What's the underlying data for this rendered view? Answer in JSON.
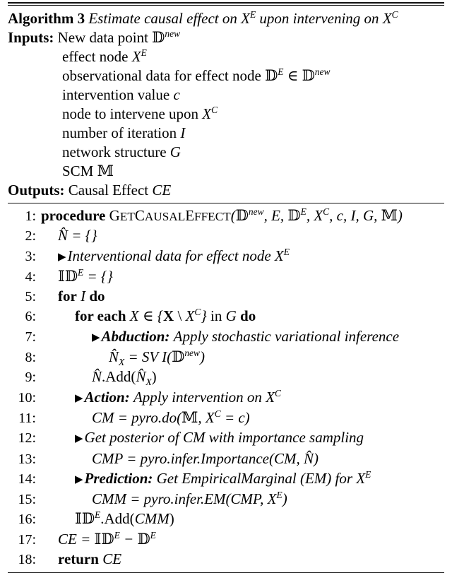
{
  "algorithm": {
    "label": "Algorithm",
    "number": "3",
    "caption": "Estimate causal effect on X^E upon intervening on X^C",
    "caption_parts": {
      "a": "Estimate causal effect on ",
      "x_effect": "X",
      "sup_e": "E",
      "b": " upon intervening on ",
      "x_cause": "X",
      "sup_c": "C"
    }
  },
  "inputs": {
    "label": "Inputs:",
    "items": [
      "New data point ℐnew",
      "effect node X^E",
      "observational data for effect node ℐ^E ∈ ℐ^new",
      "intervention value c",
      "node to intervene upon X^C",
      "number of iteration I",
      "network structure G",
      "SCM ᴹ"
    ]
  },
  "outputs": {
    "label": "Outputs:",
    "text": "Causal Effect CE"
  },
  "steps": [
    {
      "n": "1:",
      "indent": 0,
      "text": "procedure GETCAUSALEFFECT(ᴰnew, E, ᴰE, XC, c, I, G, ᴹ)"
    },
    {
      "n": "2:",
      "indent": 1,
      "text": "N̂ = {}"
    },
    {
      "n": "3:",
      "indent": 1,
      "text": "▶ Interventional data for effect node XE"
    },
    {
      "n": "4:",
      "indent": 1,
      "text": "ᵀᴰE = {}"
    },
    {
      "n": "5:",
      "indent": 1,
      "text": "for I do"
    },
    {
      "n": "6:",
      "indent": 2,
      "text": "for each X ∈ {X \\ XC} in G do"
    },
    {
      "n": "7:",
      "indent": 3,
      "text": "▶ Abduction: Apply stochastic variational inference"
    },
    {
      "n": "8:",
      "indent": 4,
      "text": "N̂X = SVI(ᴰnew)"
    },
    {
      "n": "9:",
      "indent": 3,
      "text": "N̂.Add(N̂X)"
    },
    {
      "n": "10:",
      "indent": 2,
      "text": "▶ Action: Apply intervention on XC"
    },
    {
      "n": "11:",
      "indent": 3,
      "text": "CM = pyro.do(ᴹ, XC = c)"
    },
    {
      "n": "12:",
      "indent": 2,
      "text": "▶ Get posterior of CM with importance sampling"
    },
    {
      "n": "13:",
      "indent": 3,
      "text": "CMP = pyro.infer.Importance(CM, N̂)"
    },
    {
      "n": "14:",
      "indent": 2,
      "text": "▶ Prediction: Get EmpiricalMarginal (EM) for XE"
    },
    {
      "n": "15:",
      "indent": 3,
      "text": "CMM = pyro.infer.EM(CMP, XE)"
    },
    {
      "n": "16:",
      "indent": 2,
      "text": "ᵀᴰE.Add(CMM)"
    },
    {
      "n": "17:",
      "indent": 1,
      "text": "CE = ᵀᴰE − ᴰE"
    },
    {
      "n": "18:",
      "indent": 1,
      "text": "return CE"
    }
  ],
  "symbols": {
    "blackboard_d": "𝔻",
    "blackboard_m": "𝕄",
    "triangle_marker": "▶",
    "set_membership": "∈",
    "empty_braces": "{}",
    "setminus": "\\",
    "minus": "−"
  },
  "colors": {
    "text": "#000000",
    "background": "#ffffff",
    "rule": "#111111"
  }
}
